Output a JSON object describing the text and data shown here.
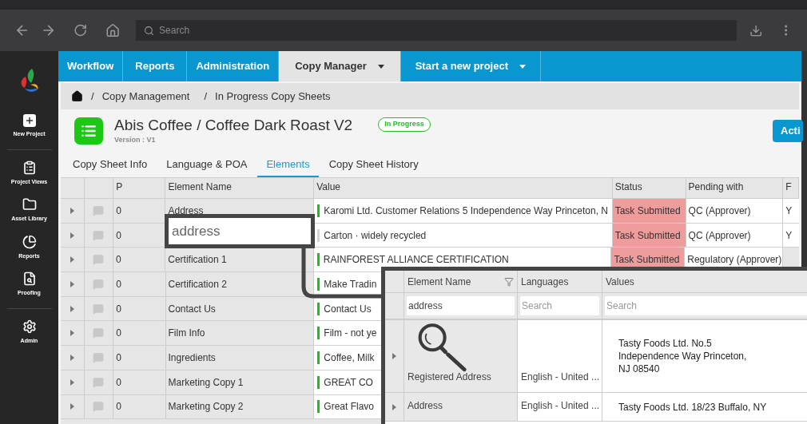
{
  "browser": {
    "search_placeholder": "Search"
  },
  "sidebar": {
    "items": [
      {
        "label": "New Project",
        "kind": "plus"
      },
      {
        "label": "Project Views",
        "kind": "views"
      },
      {
        "label": "Asset Library",
        "kind": "folder"
      },
      {
        "label": "Reports",
        "kind": "chart"
      },
      {
        "label": "Proofing",
        "kind": "proof"
      },
      {
        "label": "Admin",
        "kind": "gear"
      }
    ]
  },
  "nav": [
    {
      "label": "Workflow",
      "selected": false,
      "dropdown": false
    },
    {
      "label": "Reports",
      "selected": false,
      "dropdown": false
    },
    {
      "label": "Administration",
      "selected": false,
      "dropdown": false
    },
    {
      "label": "Copy Manager",
      "selected": true,
      "dropdown": true
    },
    {
      "label": "Start a new project",
      "selected": false,
      "dropdown": true
    }
  ],
  "breadcrumb": [
    {
      "separator": "/",
      "label": "Copy Management"
    },
    {
      "separator": "/",
      "label": "In Progress Copy Sheets"
    }
  ],
  "header": {
    "title": "Abis Coffee / Coffee Dark Roast V2",
    "version": "Version : V1",
    "status": "In Progress",
    "action_button": "Acti"
  },
  "tabs": [
    {
      "label": "Copy Sheet Info",
      "selected": false
    },
    {
      "label": "Language & POA",
      "selected": false
    },
    {
      "label": "Elements",
      "selected": true
    },
    {
      "label": "Copy Sheet History",
      "selected": false
    }
  ],
  "table": {
    "columns": [
      "P",
      "Element Name",
      "Value",
      "Status",
      "Pending with",
      "F"
    ],
    "rows": [
      {
        "p": "0",
        "name": "Address",
        "value": "Karomi Ltd. Customer Relations 5 Independence Way Princeton, N",
        "flagged": true,
        "status": "Task Submitted",
        "pending": "QC (Approver)",
        "f": "Y"
      },
      {
        "p": "0",
        "value": "Carton · widely recycled",
        "flagged": false,
        "status": "Task Submitted",
        "pending": "QC (Approver)",
        "f": "Y"
      },
      {
        "p": "0",
        "name": "Certification 1",
        "value": "RAINFOREST ALLIANCE CERTIFICATION",
        "flagged": true,
        "status": "Task Submitted",
        "pending": "Regulatory (Approver)"
      },
      {
        "p": "0",
        "name": "Certification 2",
        "value": "Make Tradin",
        "flagged": true
      },
      {
        "p": "0",
        "name": "Contact Us",
        "value": "Contact Us",
        "flagged": true
      },
      {
        "p": "0",
        "name": "Film Info",
        "value": "Film - not ye",
        "flagged": true
      },
      {
        "p": "0",
        "name": "Ingredients",
        "value": "Coffee, Milk",
        "flagged": true
      },
      {
        "p": "0",
        "name": "Marketing Copy 1",
        "value": "GREAT CO",
        "flagged": true
      },
      {
        "p": "0",
        "name": "Marketing Copy 2",
        "value": "Great Flavo",
        "flagged": true
      }
    ]
  },
  "callout": {
    "value": "address"
  },
  "inset": {
    "columns": [
      "Element Name",
      "Languages",
      "Values"
    ],
    "filters": [
      {
        "value": "address"
      },
      {
        "placeholder": "Search"
      },
      {
        "placeholder": "Search"
      }
    ],
    "rows": [
      {
        "name": "Registered Address",
        "language": "English - United ...",
        "value_lines": [
          "Tasty Foods Ltd. No.5",
          "Independence Way Princeton,",
          "NJ 08540"
        ]
      },
      {
        "name": "Address",
        "language": "English - United ...",
        "value_lines": [
          "Tasty Foods Ltd. 18/23 Buffalo, NY"
        ]
      }
    ]
  }
}
